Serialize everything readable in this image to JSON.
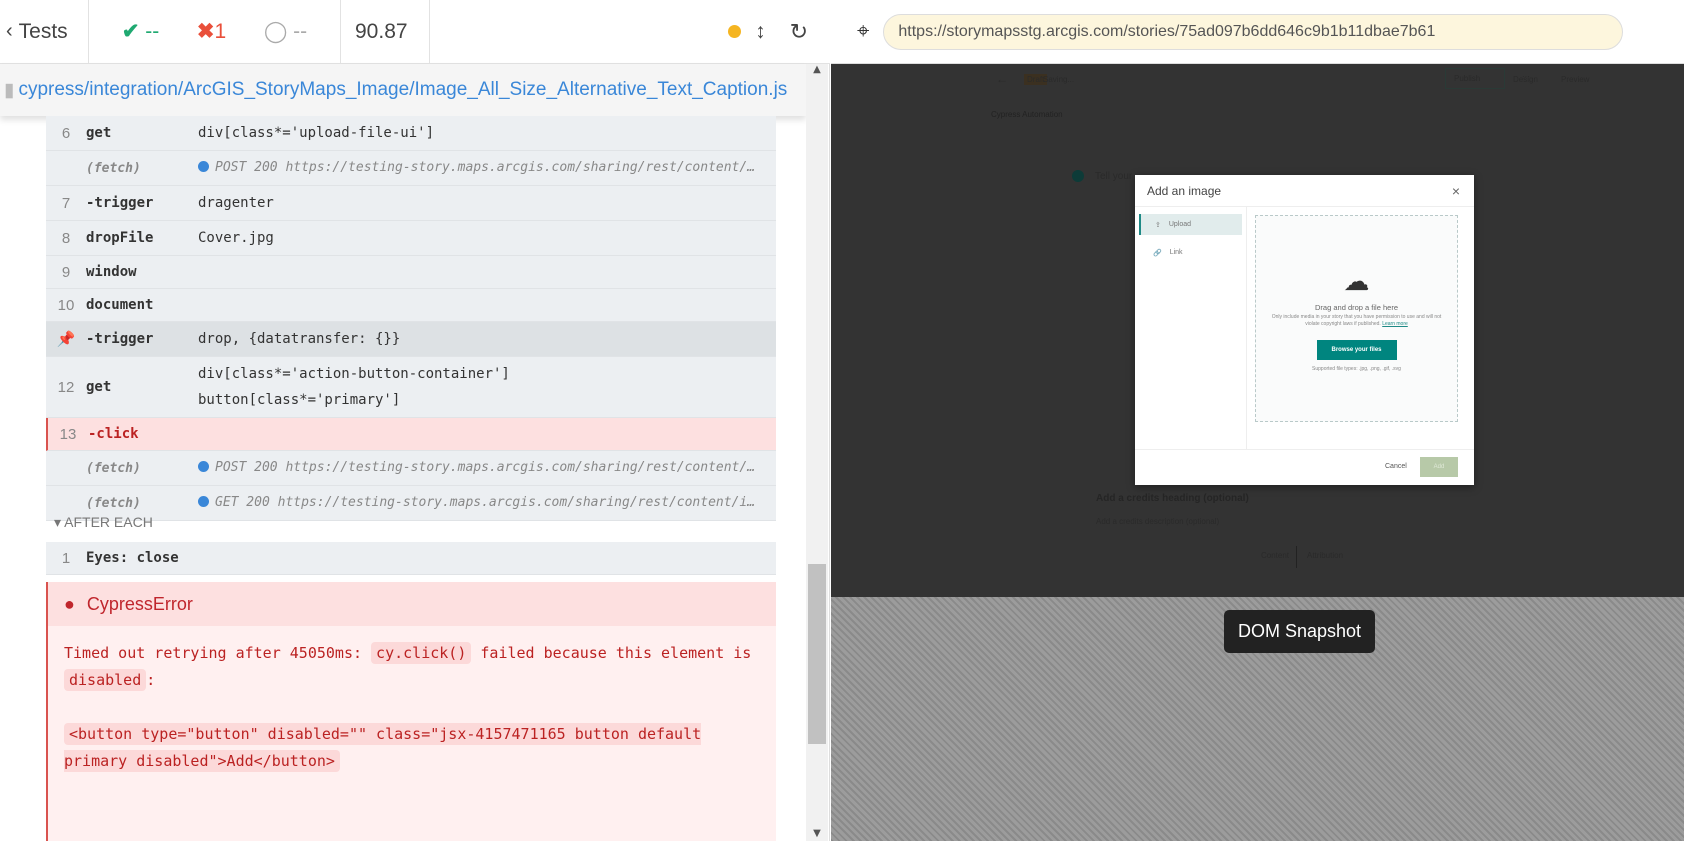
{
  "topbar": {
    "tests_label": "Tests",
    "passed": "--",
    "failed": "1",
    "pending": "--",
    "duration": "90.87"
  },
  "spec_path": "cypress/integration/ArcGIS_StoryMaps_Image/Image_All_Size_Alternative_Text_Caption.js",
  "commands": [
    {
      "num": "6",
      "cmd": "get",
      "msg": "div[class*='upload-file-ui']",
      "type": "normal"
    },
    {
      "num": "",
      "cmd": "(fetch)",
      "msg": "POST 200 https://testing-story.maps.arcgis.com/sharing/rest/content/…",
      "type": "fetch"
    },
    {
      "num": "7",
      "cmd": " -trigger",
      "msg": "dragenter",
      "type": "normal"
    },
    {
      "num": "8",
      "cmd": "dropFile",
      "msg": "Cover.jpg",
      "type": "normal"
    },
    {
      "num": "9",
      "cmd": "window",
      "msg": "",
      "type": "normal"
    },
    {
      "num": "10",
      "cmd": "document",
      "msg": "",
      "type": "normal"
    },
    {
      "num": "",
      "cmd": " -trigger",
      "msg": "drop, {datatransfer: {}}",
      "type": "pin"
    },
    {
      "num": "12",
      "cmd": "get",
      "msg": "div[class*='action-button-container']\nbutton[class*='primary']",
      "type": "normal"
    },
    {
      "num": "13",
      "cmd": " -click",
      "msg": "",
      "type": "err"
    },
    {
      "num": "",
      "cmd": "(fetch)",
      "msg": "POST 200 https://testing-story.maps.arcgis.com/sharing/rest/content/…",
      "type": "fetch"
    },
    {
      "num": "",
      "cmd": "(fetch)",
      "msg": "GET 200 https://testing-story.maps.arcgis.com/sharing/rest/content/i…",
      "type": "fetch"
    }
  ],
  "after_each": {
    "label": "AFTER EACH",
    "num": "1",
    "cmd": "Eyes: close"
  },
  "error": {
    "title": "CypressError",
    "text1": "Timed out retrying after 45050ms: ",
    "code1": "cy.click()",
    "text2": " failed because this element is ",
    "code2": "disabled",
    "text3": ":",
    "code3": "<button type=\"button\" disabled=\"\" class=\"jsx-4157471165 button default primary disabled\">Add</button>"
  },
  "url": "https://storymapsstg.arcgis.com/stories/75ad097b6dd646c9b1b11dbae7b61",
  "app": {
    "draft": "Draft",
    "saving": "Saving...",
    "design": "Design",
    "preview": "Preview",
    "publish": "Publish",
    "story_title": "Cypress Automation",
    "tell": "Tell your",
    "credits_heading": "Add a credits heading (optional)",
    "credits_desc": "Add a credits description (optional)",
    "content": "Content",
    "attribution": "Attribution"
  },
  "modal": {
    "title": "Add an image",
    "upload": "Upload",
    "link": "Link",
    "drag": "Drag and drop a file here",
    "notice": "Only include media in your story that you have permission to use and will not violate copyright laws if published.",
    "learn_more": "Learn more",
    "browse": "Browse your files",
    "supported": "Supported file types: .jpg, .png, .gif, .svg",
    "cancel": "Cancel",
    "add": "Add"
  },
  "snapshot_label": "DOM Snapshot",
  "colors": {
    "pass": "#1fa971",
    "fail": "#e94f3a",
    "running": "#f5b521",
    "link": "#3a87d8",
    "teal": "#1f8a86"
  }
}
